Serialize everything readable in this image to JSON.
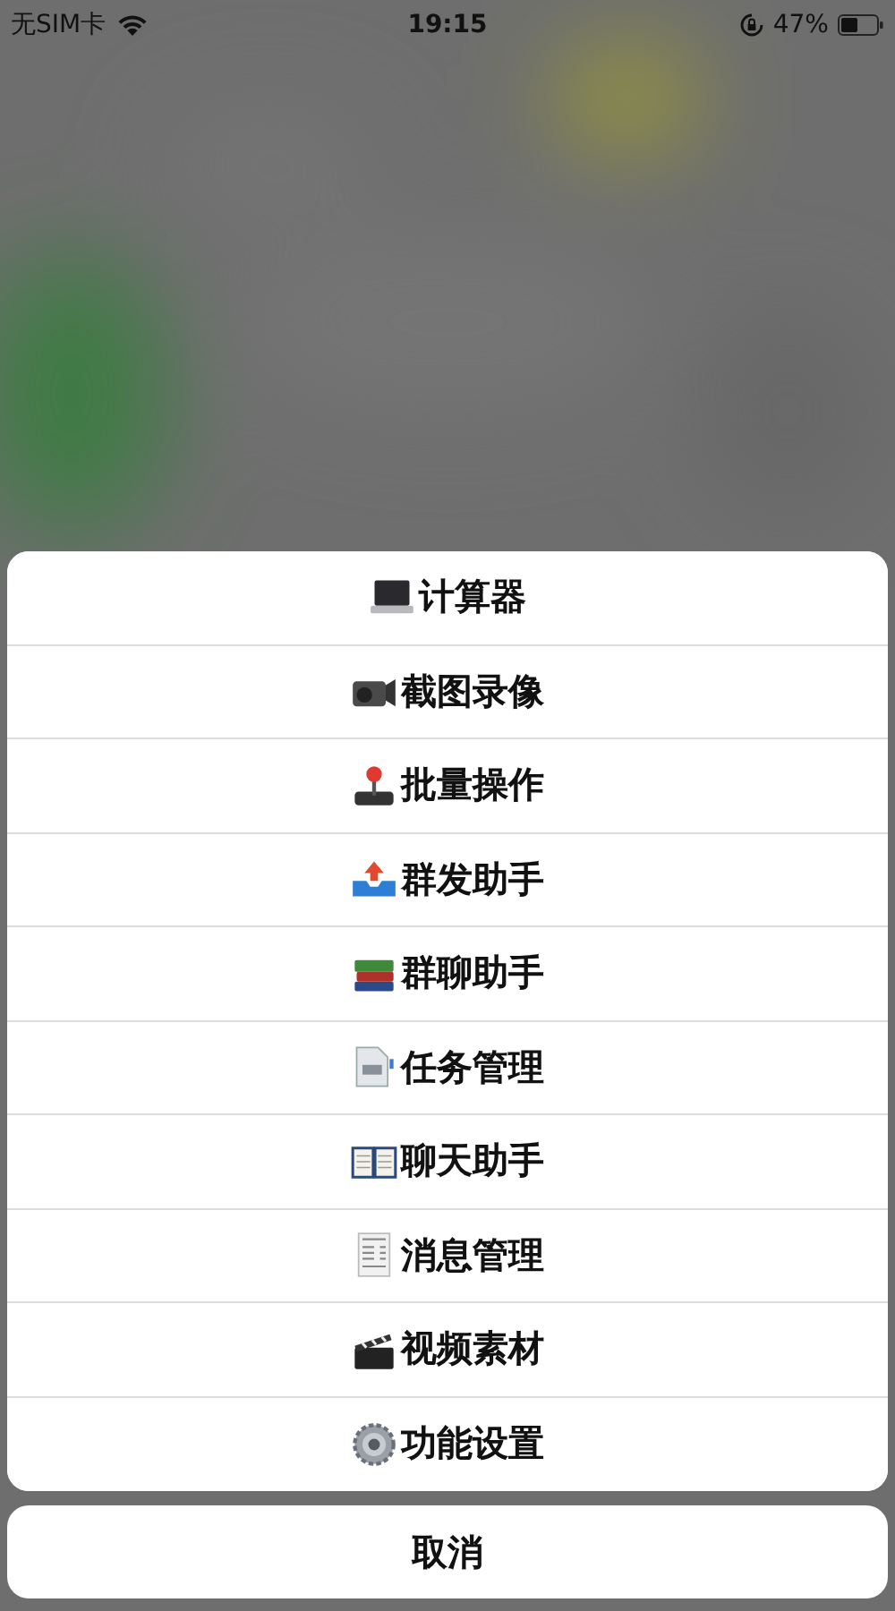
{
  "status_bar": {
    "carrier": "无SIM卡",
    "time": "19:15",
    "battery": "47%"
  },
  "action_sheet": {
    "items": [
      {
        "label": "计算器",
        "kind": "laptop"
      },
      {
        "label": "截图录像",
        "kind": "camcorder"
      },
      {
        "label": "批量操作",
        "kind": "joystick"
      },
      {
        "label": "群发助手",
        "kind": "inbox"
      },
      {
        "label": "群聊助手",
        "kind": "books"
      },
      {
        "label": "任务管理",
        "kind": "document"
      },
      {
        "label": "聊天助手",
        "kind": "book"
      },
      {
        "label": "消息管理",
        "kind": "receipt"
      },
      {
        "label": "视频素材",
        "kind": "clapper"
      },
      {
        "label": "功能设置",
        "kind": "gear"
      }
    ],
    "cancel": "取消"
  }
}
